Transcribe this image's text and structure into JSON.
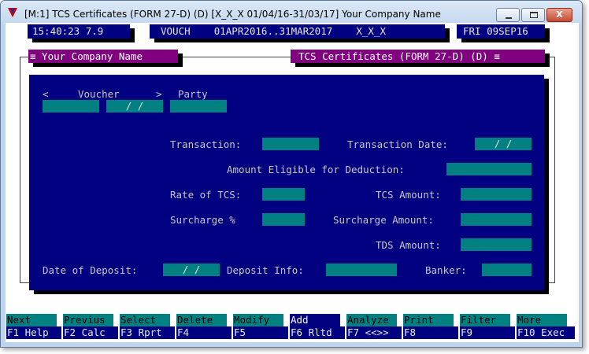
{
  "window": {
    "title": "[M:1]  TCS Certificates (FORM 27-D) (D)  [X_X_X  01/04/16-31/03/17]  Your Company Name",
    "close_glyph": "X"
  },
  "status": {
    "time_version": "15:40:23 7.9",
    "period": "VOUCH    01APR2016..31MAR2017    X_X_X",
    "date": "FRI 09SEP16"
  },
  "panels": {
    "company_title": "≡ Your Company Name",
    "form_title": "TCS Certificates (FORM 27-D) (D) ≡"
  },
  "form": {
    "header": {
      "prev": "<",
      "voucher": "Voucher",
      "next": ">",
      "party": "Party"
    },
    "voucher_date_value": "/ /",
    "labels": {
      "transaction": "Transaction:",
      "transaction_date": "Transaction Date:",
      "amount_eligible": "Amount Eligible for Deduction:",
      "rate_of_tcs": "Rate of TCS:",
      "tcs_amount": "TCS Amount:",
      "surcharge_pct": "Surcharge %",
      "surcharge_amount": "Surcharge Amount:",
      "tds_amount": "TDS Amount:",
      "date_of_deposit": "Date of Deposit:",
      "deposit_info": "Deposit Info:",
      "banker": "Banker:"
    },
    "values": {
      "transaction": "",
      "transaction_date": "/ /",
      "amount_eligible": "",
      "rate_of_tcs": "",
      "tcs_amount": "",
      "surcharge_pct": "",
      "surcharge_amount": "",
      "tds_amount": "",
      "date_of_deposit": "/ /",
      "deposit_info": "",
      "banker": ""
    }
  },
  "fkeys": [
    {
      "action": "Next",
      "key": "F1 Help"
    },
    {
      "action": "Previus",
      "key": "F2 Calc"
    },
    {
      "action": "Select",
      "key": "F3 Rprt"
    },
    {
      "action": "Delete",
      "key": "F4"
    },
    {
      "action": "Modify",
      "key": "F5"
    },
    {
      "action": "Add",
      "key": "F6 Rltd"
    },
    {
      "action": "Analyze",
      "key": "F7 <<>>"
    },
    {
      "action": "Print",
      "key": "F8"
    },
    {
      "action": "Filter",
      "key": "F9"
    },
    {
      "action": "More",
      "key": "F10 Exec"
    }
  ],
  "colors": {
    "panel_blue": "#000080",
    "field_teal": "#008080",
    "title_purple": "#800080"
  }
}
